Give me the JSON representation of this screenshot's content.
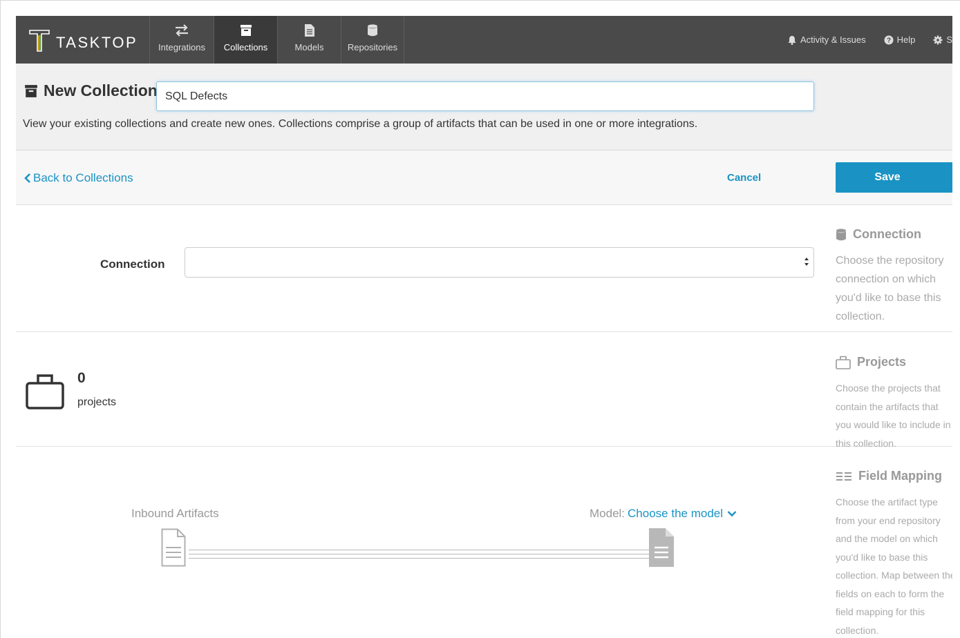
{
  "brand": {
    "logo_text": "TASKTOP"
  },
  "nav": {
    "items": [
      {
        "label": "Integrations",
        "icon": "arrows-exchange-icon",
        "active": false
      },
      {
        "label": "Collections",
        "icon": "archive-box-icon",
        "active": true
      },
      {
        "label": "Models",
        "icon": "document-icon",
        "active": false
      },
      {
        "label": "Repositories",
        "icon": "database-icon",
        "active": false
      }
    ],
    "right": {
      "activity_label": "Activity & Issues",
      "help_label": "Help",
      "settings_label": "S"
    }
  },
  "header": {
    "title": "New Collection",
    "name_value": "SQL Defects",
    "description": "View your existing collections and create new ones. Collections comprise a group of artifacts that can be used in one or more integrations."
  },
  "actions": {
    "back_label": "Back to Collections",
    "cancel_label": "Cancel",
    "save_label": "Save"
  },
  "connection": {
    "label": "Connection",
    "selected_value": ""
  },
  "projects": {
    "count": "0",
    "label": "projects"
  },
  "mapping": {
    "inbound_label": "Inbound Artifacts",
    "model_prefix": "Model:",
    "model_link": "Choose the model"
  },
  "help": {
    "connection": {
      "title": "Connection",
      "body": "Choose the repository connection on which you'd like to base this collection."
    },
    "projects": {
      "title": "Projects",
      "body": "Choose the projects that contain the artifacts that you would like to include in this collection."
    },
    "field_mapping": {
      "title": "Field Mapping",
      "body": "Choose the artifact type from your end repository and the model on which you'd like to base this collection. Map between the fields on each to form the field mapping for this collection."
    }
  },
  "colors": {
    "navbar": "#4a4a4a",
    "accent": "#1a93c4",
    "header_bg": "#f0f0f0",
    "muted_text": "#aaaaaa"
  }
}
